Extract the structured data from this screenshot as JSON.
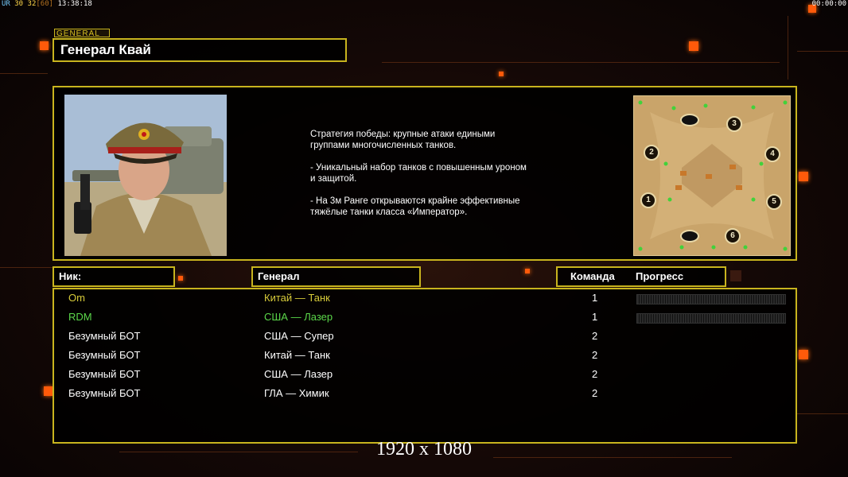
{
  "hud": {
    "ur": "UR",
    "fps_a": "30",
    "fps_b": "32",
    "fps_cap": "[60]",
    "clock": "13:38:18",
    "timer": "00:00:00"
  },
  "general": {
    "tag": "GENERAL",
    "name": "Генерал Квай",
    "description": "Стратегия победы: крупные атаки едиными\n группами многочисленных танков.\n\n- Уникальный набор танков с повышенным уроном\n и защитой.\n\n- На 3м Ранге открываются крайне эффективные\n тяжёлые танки класса «Император»."
  },
  "minimap": {
    "slots": [
      "1",
      "2",
      "3",
      "4",
      "5",
      "6"
    ]
  },
  "headers": {
    "nick": "Ник:",
    "general": "Генерал",
    "team": "Команда",
    "progress": "Прогресс"
  },
  "players": [
    {
      "nick": "Om",
      "general": "Китай — Танк",
      "team": "1",
      "color": "#d8cc3a",
      "progress": 0
    },
    {
      "nick": "RDM",
      "general": "США — Лазер",
      "team": "1",
      "color": "#5cd84a",
      "progress": 0
    },
    {
      "nick": "Безумный БОТ",
      "general": "США — Супер",
      "team": "2",
      "color": "#ffffff"
    },
    {
      "nick": "Безумный БОТ",
      "general": "Китай — Танк",
      "team": "2",
      "color": "#ffffff"
    },
    {
      "nick": "Безумный БОТ",
      "general": "США — Лазер",
      "team": "2",
      "color": "#ffffff"
    },
    {
      "nick": "Безумный БОТ",
      "general": "ГЛА — Химик",
      "team": "2",
      "color": "#ffffff"
    }
  ],
  "resolution": "1920 x 1080",
  "colors": {
    "frame": "#c8b41e",
    "accent": "#ff5a0a"
  }
}
